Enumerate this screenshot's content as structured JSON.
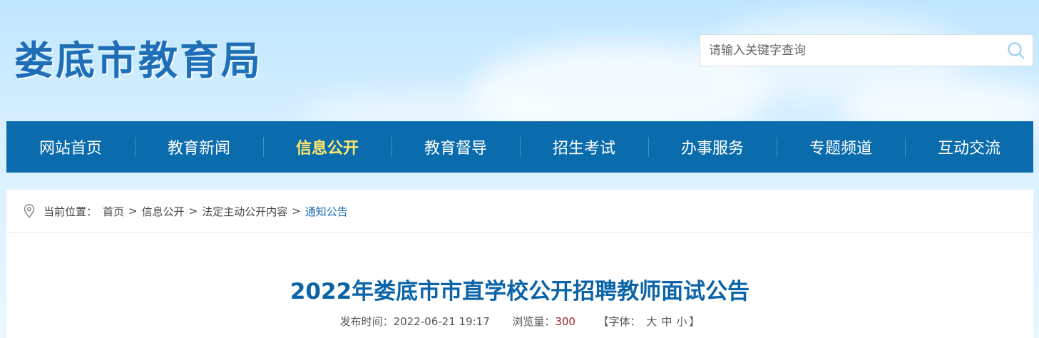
{
  "header": {
    "site_title": "娄底市教育局",
    "search_placeholder": "请输入关键字查询"
  },
  "nav": {
    "items": [
      "网站首页",
      "教育新闻",
      "信息公开",
      "教育督导",
      "招生考试",
      "办事服务",
      "专题频道",
      "互动交流"
    ],
    "active": "信息公开"
  },
  "breadcrumb": {
    "prefix": "当前位置：",
    "items": [
      "首页",
      "信息公开",
      "法定主动公开内容",
      "通知公告"
    ],
    "separator": ">"
  },
  "article": {
    "title": "2022年娄底市市直学校公开招聘教师面试公告",
    "publish_label": "发布时间：",
    "publish_time": "2022-06-21 19:17",
    "views_label": "浏览量：",
    "views": "300",
    "font_label": "【字体：",
    "font_large": "大",
    "font_medium": "中",
    "font_small": "小",
    "font_close": "】"
  },
  "colors": {
    "nav_bg": "#0b6cad",
    "nav_active": "#ffe86b",
    "title": "#0b63a8",
    "site_title": "#1f6fb8"
  }
}
